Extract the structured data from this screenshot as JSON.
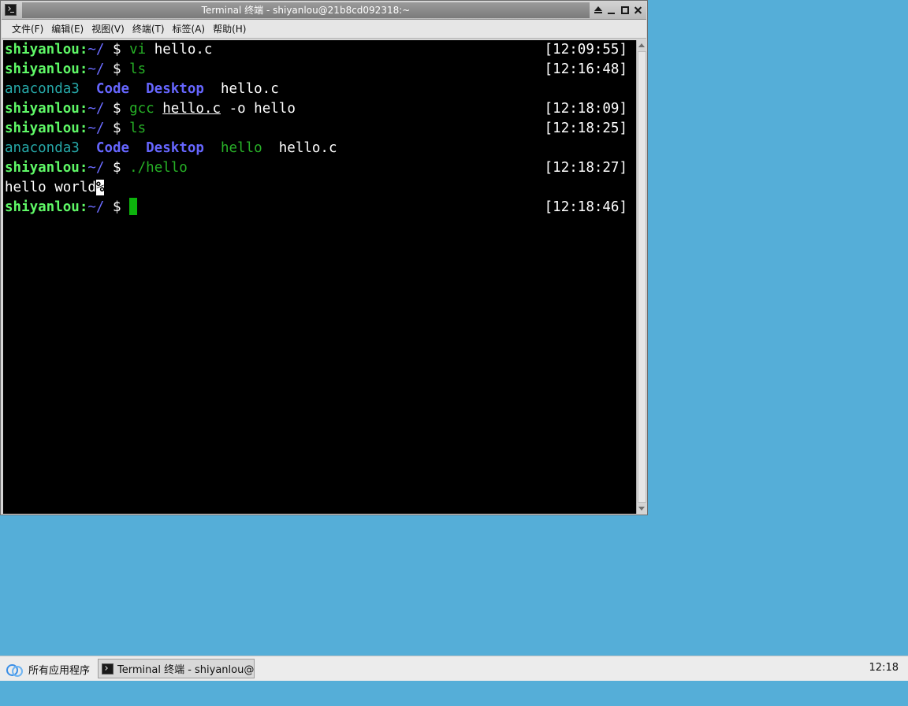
{
  "window": {
    "title": "Terminal 终端 - shiyanlou@21b8cd092318:~"
  },
  "menubar": {
    "items": [
      "文件(F)",
      "编辑(E)",
      "视图(V)",
      "终端(T)",
      "标签(A)",
      "帮助(H)"
    ]
  },
  "terminal": {
    "user": "shiyanlou",
    "path": "~/",
    "prompt": "$",
    "lines": [
      {
        "cmd": "vi",
        "args": "hello.c",
        "time": "[12:09:55]"
      },
      {
        "cmd": "ls",
        "time": "[12:16:48]"
      },
      {
        "out": [
          "anaconda3",
          "Code",
          "Desktop",
          "hello.c"
        ]
      },
      {
        "cmd": "gcc",
        "arg_file": "hello.c",
        "args_rest": "-o hello",
        "time": "[12:18:09]"
      },
      {
        "cmd": "ls",
        "time": "[12:18:25]"
      },
      {
        "out": [
          "anaconda3",
          "Code",
          "Desktop",
          "hello",
          "hello.c"
        ]
      },
      {
        "cmd": "./hello",
        "time": "[12:18:27]"
      },
      {
        "text": "hello world",
        "marker": "%"
      },
      {
        "time": "[12:18:46]"
      }
    ]
  },
  "taskbar": {
    "start_label": "所有应用程序",
    "task_label": "Terminal 终端 - shiyanlou@···",
    "clock": "12:18"
  },
  "colors": {
    "desktop": "#55aed8",
    "terminal_bg": "#000000",
    "user": "#5ff967",
    "path": "#6b6bff",
    "command": "#26b026",
    "dir_cyan": "#26a8a8",
    "dir_blue": "#6666ff",
    "cursor": "#0db30d"
  }
}
